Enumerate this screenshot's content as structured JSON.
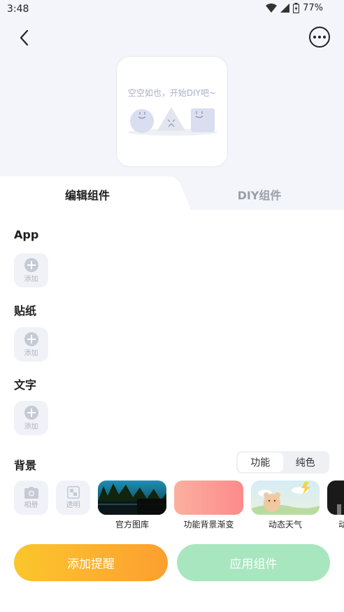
{
  "status_bar": {
    "time": "3:48",
    "battery": "77%"
  },
  "header": {
    "back_icon": "chevron-left-icon",
    "more_icon": "more-horizontal-icon"
  },
  "preview": {
    "empty_text": "空空如也，开始DIY吧~"
  },
  "tabs": [
    {
      "label": "编辑组件",
      "active": true
    },
    {
      "label": "DIY组件",
      "active": false
    }
  ],
  "sections": {
    "app": {
      "title": "App",
      "add_label": "添加"
    },
    "sticker": {
      "title": "贴纸",
      "add_label": "添加"
    },
    "text": {
      "title": "文字",
      "add_label": "添加"
    }
  },
  "background": {
    "title": "背景",
    "segments": [
      {
        "label": "功能",
        "selected": true
      },
      {
        "label": "纯色",
        "selected": false
      }
    ],
    "album_label": "相册",
    "transparent_label": "透明",
    "thumbnails": [
      {
        "caption": "官方图库"
      },
      {
        "caption": "功能背景渐变"
      },
      {
        "caption": "动态天气"
      },
      {
        "caption": "动"
      }
    ]
  },
  "actions": {
    "add_reminder": "添加提醒",
    "apply_widget": "应用组件"
  },
  "colors": {
    "accent_orange": "#fd9f30",
    "accent_yellow": "#fbc62c",
    "apply_green": "#a8e6c0"
  }
}
